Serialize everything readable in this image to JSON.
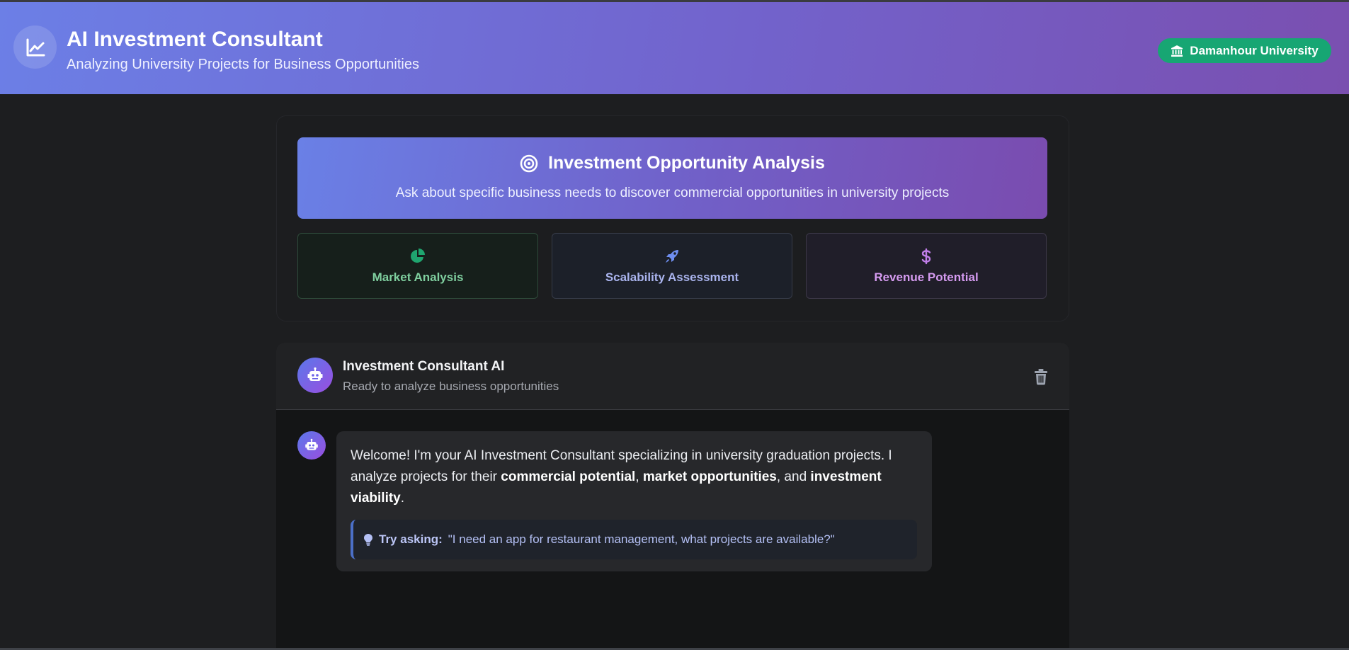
{
  "header": {
    "title": "AI Investment Consultant",
    "subtitle": "Analyzing University Projects for Business Opportunities",
    "badge": "Damanhour University",
    "logo_icon": "chart-line-icon",
    "badge_icon": "university-icon"
  },
  "analysis": {
    "title": "Investment Opportunity Analysis",
    "subtitle": "Ask about specific business needs to discover commercial opportunities in university projects",
    "title_icon": "target-icon",
    "features": [
      {
        "label": "Market Analysis",
        "icon": "pie-chart-icon",
        "color": "#1fa56f"
      },
      {
        "label": "Scalability Assessment",
        "icon": "rocket-icon",
        "color": "#6f8ef0"
      },
      {
        "label": "Revenue Potential",
        "icon": "dollar-icon",
        "color": "#c07ee8"
      }
    ]
  },
  "chat": {
    "bot_name": "Investment Consultant AI",
    "status": "Ready to analyze business opportunities",
    "clear_icon": "trash-icon",
    "welcome": {
      "part1": "Welcome! I'm your AI Investment Consultant specializing in university graduation projects. I analyze projects for their ",
      "bold1": "commercial potential",
      "sep1": ", ",
      "bold2": "market opportunities",
      "sep2": ", and ",
      "bold3": "investment viability",
      "end": "."
    },
    "tip": {
      "label": "Try asking:",
      "text": "\"I need an app for restaurant management, what projects are available?\"",
      "icon": "lightbulb-icon"
    }
  },
  "colors": {
    "header_gradient_start": "#6c7fe6",
    "header_gradient_end": "#7a4fb0",
    "badge": "#17a673",
    "background": "#1d1e20"
  }
}
